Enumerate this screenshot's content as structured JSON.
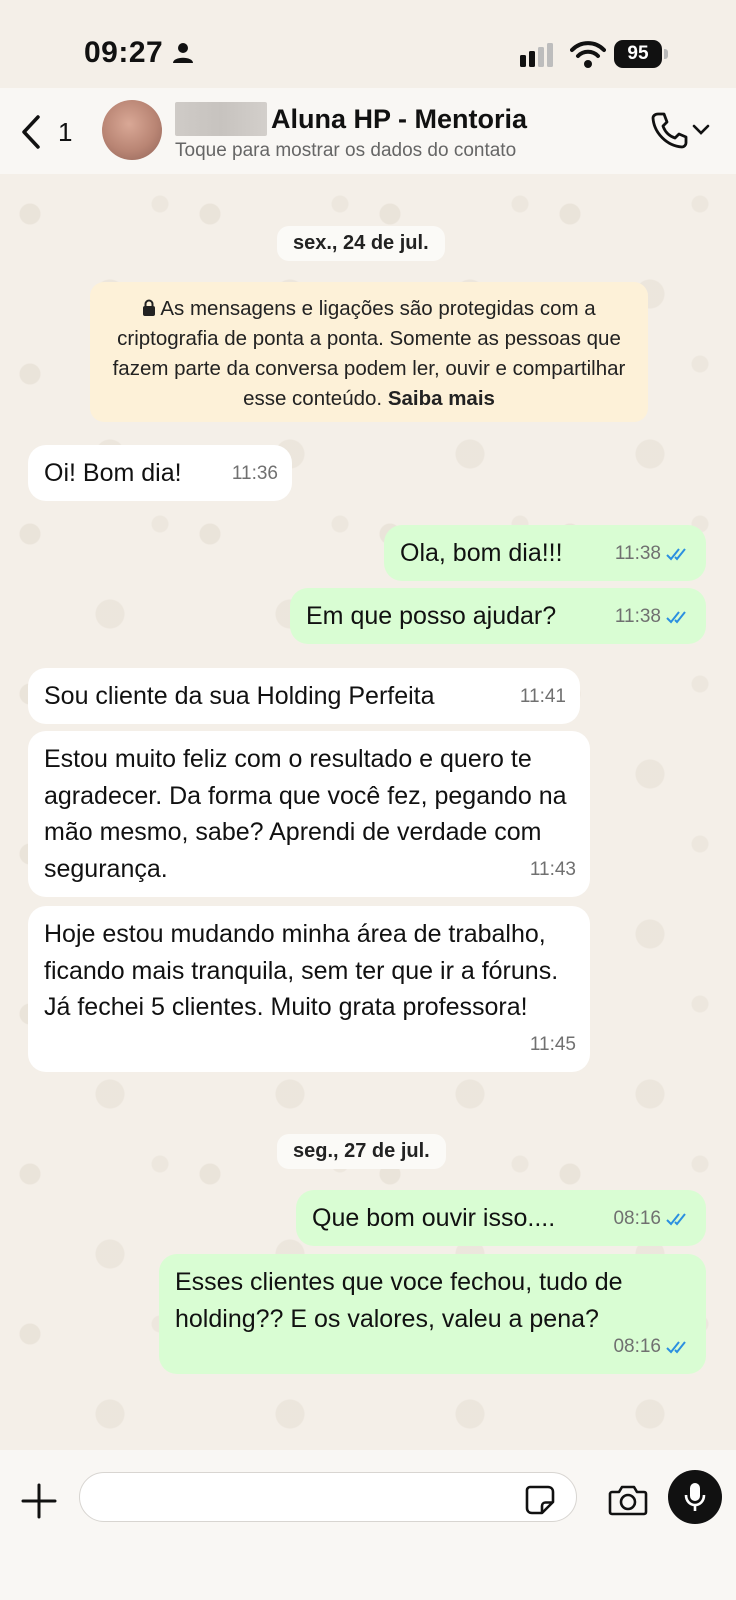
{
  "status_bar": {
    "time": "09:27",
    "battery": "95"
  },
  "header": {
    "back_count": "1",
    "contact_name": "Aluna HP - Mentoria",
    "subtitle": "Toque para mostrar os dados do contato"
  },
  "chat": {
    "date_1": "sex., 24 de jul.",
    "encryption_text": "As mensagens e ligações são protegidas com a criptografia de ponta a ponta. Somente as pessoas que fazem parte da conversa podem ler, ouvir e compartilhar esse conteúdo.",
    "encryption_link": "Saiba mais",
    "date_2": "seg., 27 de jul.",
    "messages": [
      {
        "direction": "in",
        "text": "Oi! Bom dia!",
        "time": "11:36"
      },
      {
        "direction": "out",
        "text": "Ola, bom dia!!!",
        "time": "11:38",
        "status": "read"
      },
      {
        "direction": "out",
        "text": "Em que posso ajudar?",
        "time": "11:38",
        "status": "read"
      },
      {
        "direction": "in",
        "text": "Sou cliente da sua Holding Perfeita",
        "time": "11:41"
      },
      {
        "direction": "in",
        "text": "Estou muito feliz com o resultado e quero te agradecer. Da forma que você fez, pegando na mão mesmo, sabe? Aprendi de verdade com segurança.",
        "time": "11:43"
      },
      {
        "direction": "in",
        "text": "Hoje estou mudando minha área de trabalho, ficando mais tranquila, sem ter que ir a fóruns. Já fechei 5 clientes. Muito grata professora!",
        "time": "11:45"
      },
      {
        "direction": "out",
        "text": "Que bom ouvir isso....",
        "time": "08:16",
        "status": "read"
      },
      {
        "direction": "out",
        "text": "Esses clientes que voce fechou, tudo de holding?? E os valores, valeu a pena?",
        "time": "08:16",
        "status": "read"
      }
    ]
  },
  "composer": {
    "input_value": ""
  },
  "colors": {
    "incoming": "#ffffff",
    "outgoing": "#d9fdd3",
    "read_check": "#2b8fe0",
    "background": "#f4efe8"
  },
  "icons": [
    "person-icon",
    "signal-icon",
    "wifi-icon",
    "back-icon",
    "phone-icon",
    "chevron-down-icon",
    "lock-icon",
    "double-check-icon",
    "plus-icon",
    "sticker-icon",
    "camera-icon",
    "mic-icon"
  ]
}
